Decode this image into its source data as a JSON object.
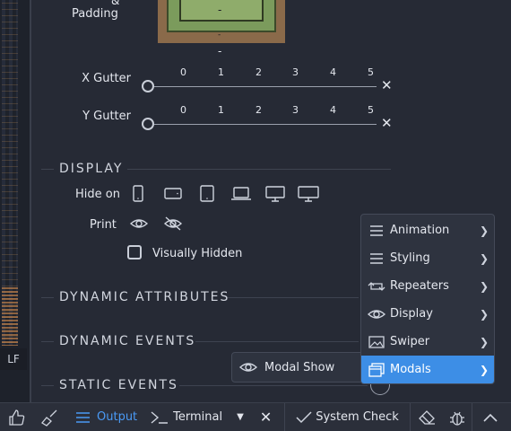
{
  "padding_box": {
    "label": "Padding",
    "amp": "&",
    "dash_center": "-",
    "dash_bottom": "-",
    "dash_below": "-"
  },
  "sliders": [
    {
      "label": "X Gutter",
      "ticks": [
        "0",
        "1",
        "2",
        "3",
        "4",
        "5"
      ],
      "value": 0
    },
    {
      "label": "Y Gutter",
      "ticks": [
        "0",
        "1",
        "2",
        "3",
        "4",
        "5"
      ],
      "value": 0
    }
  ],
  "display": {
    "title": "DISPLAY",
    "hide_on_label": "Hide on",
    "devices": [
      "mobile-portrait-icon",
      "mobile-landscape-icon",
      "tablet-icon",
      "laptop-icon",
      "desktop-icon",
      "widescreen-icon"
    ],
    "print_label": "Print",
    "visually_hidden_label": "Visually Hidden"
  },
  "sections": {
    "dynamic_attributes": "DYNAMIC ATTRIBUTES",
    "dynamic_events": "DYNAMIC EVENTS",
    "static_events": "STATIC EVENTS"
  },
  "context_menu": {
    "items": [
      {
        "label": "Animation",
        "icon": "lines-icon"
      },
      {
        "label": "Styling",
        "icon": "lines-icon"
      },
      {
        "label": "Repeaters",
        "icon": "repeat-icon"
      },
      {
        "label": "Display",
        "icon": "eye-icon"
      },
      {
        "label": "Swiper",
        "icon": "image-icon"
      },
      {
        "label": "Modals",
        "icon": "window-icon",
        "active": true
      }
    ],
    "submenu": {
      "label": "Modal Show",
      "icon": "eye-icon"
    }
  },
  "sidebar": {
    "lf_label": "LF"
  },
  "statusbar": {
    "output": "Output",
    "terminal": "Terminal",
    "system_check": "System Check"
  },
  "colors": {
    "accent": "#3d8ee6",
    "bg": "#262a35"
  }
}
